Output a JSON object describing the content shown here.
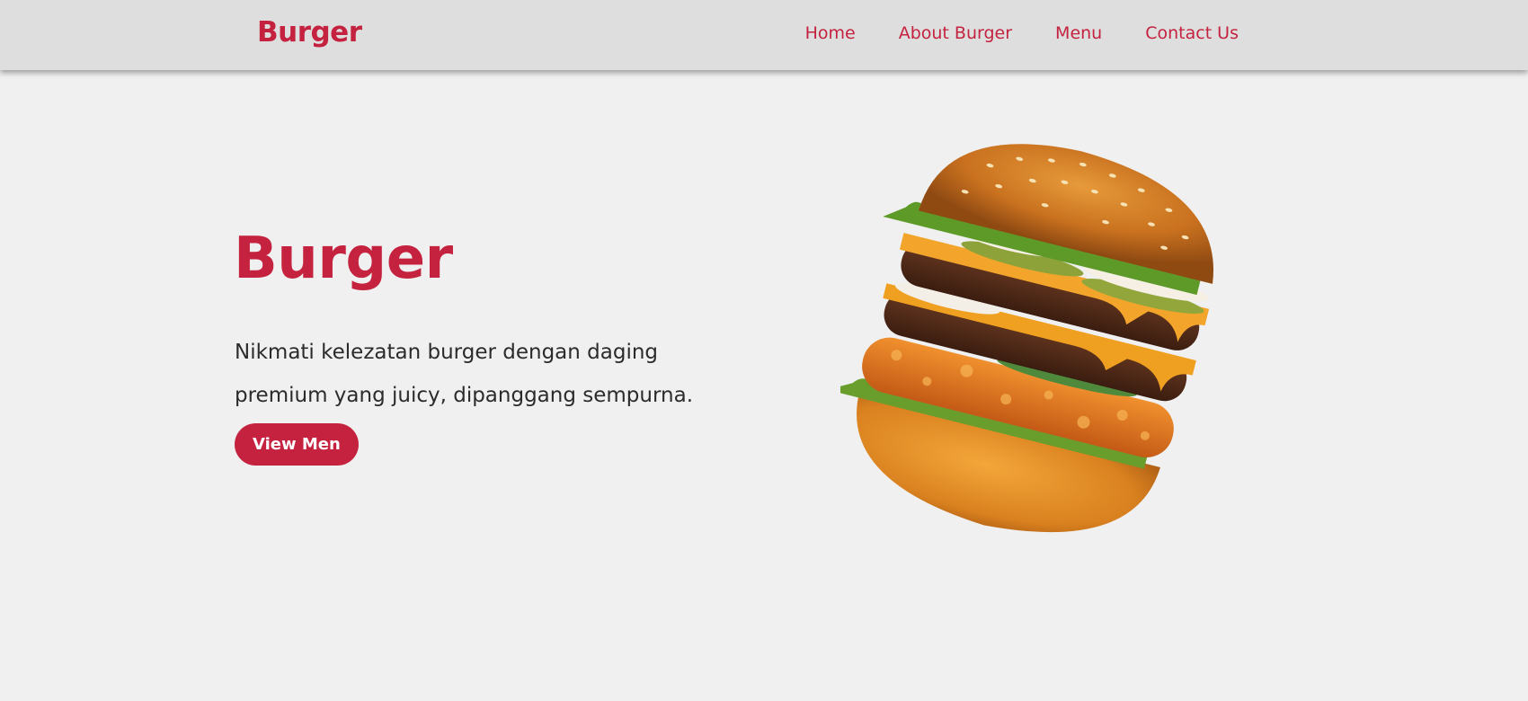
{
  "header": {
    "logo": "Burger",
    "nav": [
      {
        "label": "Home"
      },
      {
        "label": "About Burger"
      },
      {
        "label": "Menu"
      },
      {
        "label": "Contact Us"
      }
    ]
  },
  "hero": {
    "title": "Burger",
    "description": "Nikmati kelezatan burger dengan daging premium yang juicy, dipanggang sempurna.",
    "button_label": "View Men",
    "image_icon": "burger-image"
  },
  "colors": {
    "accent": "#c4223f",
    "header_bg": "#dedede",
    "page_bg": "#f0f0f0",
    "text": "#2b2b2b"
  }
}
